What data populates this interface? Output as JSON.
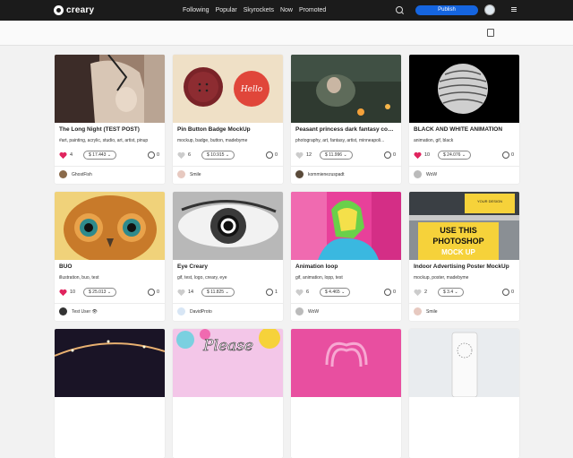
{
  "header": {
    "logo_text": "creary",
    "nav": [
      "Following",
      "Popular",
      "Skyrockets",
      "Now",
      "Promoted"
    ],
    "publish_label": "Publish"
  },
  "colors": {
    "accent": "#1565e0",
    "heart_liked": "#e0245e",
    "heart_unliked": "#cccccc"
  },
  "cards": [
    {
      "title": "The Long Night (TEST POST)",
      "tags": "#art, painting, acrylic, studio, art, artist, pinup",
      "likes": "4",
      "price": "$ 17.443 ⌄",
      "comments": "0",
      "user": "GhostFish",
      "liked": true
    },
    {
      "title": "Pin Button Badge MockUp",
      "tags": "mockup, badge, button, madebyme",
      "likes": "6",
      "price": "$ 10.915 ⌄",
      "comments": "0",
      "user": "Smile",
      "liked": false
    },
    {
      "title": "Peasant princess dark fantasy conc...",
      "tags": "photography, art, fantasy, artist, minneapoli...",
      "likes": "12",
      "price": "$ 11.996 ⌄",
      "comments": "0",
      "user": "kommienezuspadt",
      "liked": false
    },
    {
      "title": "BLACK AND WHITE ANIMATION",
      "tags": "animation, gif, black",
      "likes": "10",
      "price": "$ 24.076 ⌄",
      "comments": "0",
      "user": "WoW",
      "liked": true
    },
    {
      "title": "BUO",
      "tags": "illustration, buo, test",
      "likes": "10",
      "price": "$ 25.013 ⌄",
      "comments": "0",
      "user": "Test User 👁",
      "liked": true
    },
    {
      "title": "Eye Creary",
      "tags": "gif, test, logo, creary, eye",
      "likes": "14",
      "price": "$ 11.825 ⌄",
      "comments": "1",
      "user": "DavidProto",
      "liked": false
    },
    {
      "title": "Animation loop",
      "tags": "gif, animation, lopp, test",
      "likes": "6",
      "price": "$ 4.465 ⌄",
      "comments": "0",
      "user": "WoW",
      "liked": false
    },
    {
      "title": "Indoor Advertising Poster MockUp",
      "tags": "mockup, poster, madebyme",
      "likes": "2",
      "price": "$ 3.4 ⌄",
      "comments": "0",
      "user": "Smile",
      "liked": false
    }
  ],
  "thumb_texts": {
    "pin_hello": "Hello",
    "poster_line1": "USE THIS",
    "poster_line2": "PHOTOSHOP",
    "poster_line3": "MOCK UP",
    "poster_top": "YOUR DESIGN",
    "please": "Please"
  }
}
